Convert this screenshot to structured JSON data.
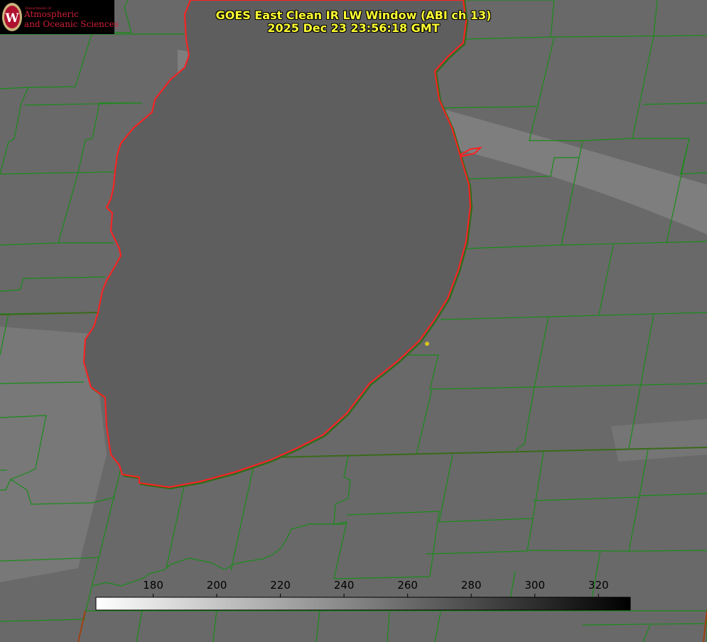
{
  "title": {
    "line1": "GOES East Clean IR LW Window (ABI ch 13)",
    "line2": "2025 Dec 23 23:56:18 GMT"
  },
  "logo": {
    "department": "Department of",
    "line1": "Atmospheric",
    "line2": "and Oceanic Sciences",
    "seal_letter": "W",
    "color": "#d0203a"
  },
  "colorbar": {
    "ticks": [
      "180",
      "200",
      "220",
      "240",
      "260",
      "280",
      "300",
      "320"
    ],
    "range": [
      162,
      330
    ],
    "gradient": [
      "#ffffff",
      "#000000"
    ]
  },
  "colors": {
    "title": "#ffff33",
    "county_lines": "#1a8c1a",
    "lake_shore": "#ff2020",
    "marker": "#d4c21e"
  }
}
